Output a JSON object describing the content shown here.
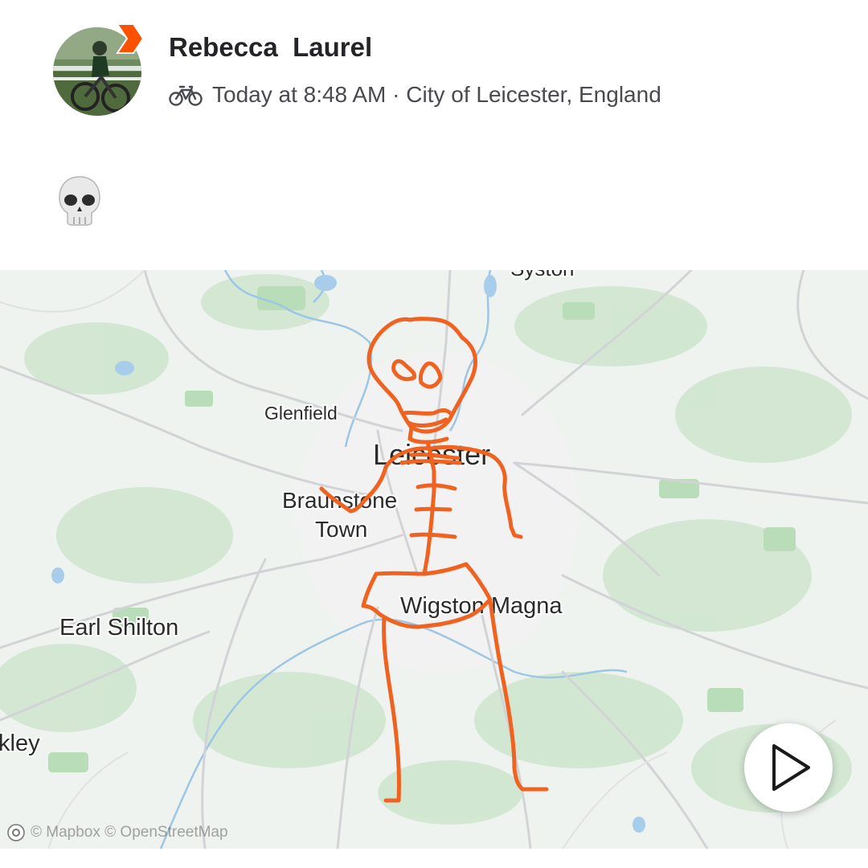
{
  "activity": {
    "athlete_name": "Rebecca  Laurel",
    "activity_type_icon": "bike-icon",
    "timestamp": "Today at 8:48 AM",
    "separator": " · ",
    "location": "City of Leicester, England",
    "description_emoji": "skull-emoji",
    "badge_icon": "subscriber-chevron-icon"
  },
  "map": {
    "place_labels": {
      "syston": "Syston",
      "glenfield": "Glenfield",
      "leicester": "Leicester",
      "braunstone_line1": "Braunstone",
      "braunstone_line2": "Town",
      "wigston": "Wigston Magna",
      "earl_shilton": "Earl Shilton",
      "hinckley": "kley"
    },
    "route_color": "#f0621f",
    "play_icon": "play-icon",
    "attribution": "© Mapbox © OpenStreetMap"
  }
}
